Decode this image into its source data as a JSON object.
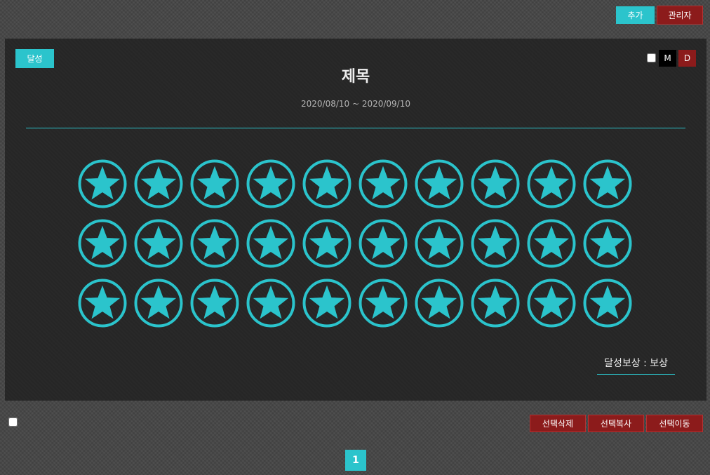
{
  "toolbar": {
    "add_label": "추가",
    "admin_label": "관리자"
  },
  "post": {
    "status": "달성",
    "title": "제목",
    "period": "2020/08/10 ~ 2020/09/10",
    "reward": "달성보상 : 보상",
    "mode_m": "M",
    "mode_d": "D"
  },
  "stamps": {
    "total": 30,
    "achieved": 30,
    "rows": 3,
    "columns": 10,
    "icon": "star-in-circle-icon",
    "color": "#2bc4cc"
  },
  "actions": {
    "delete_label": "선택삭제",
    "copy_label": "선택복사",
    "move_label": "선택이동"
  },
  "pagination": {
    "current_page": "1"
  },
  "colors": {
    "accent": "#2bc4cc",
    "danger": "#8c1b1b",
    "panel": "#262626"
  }
}
